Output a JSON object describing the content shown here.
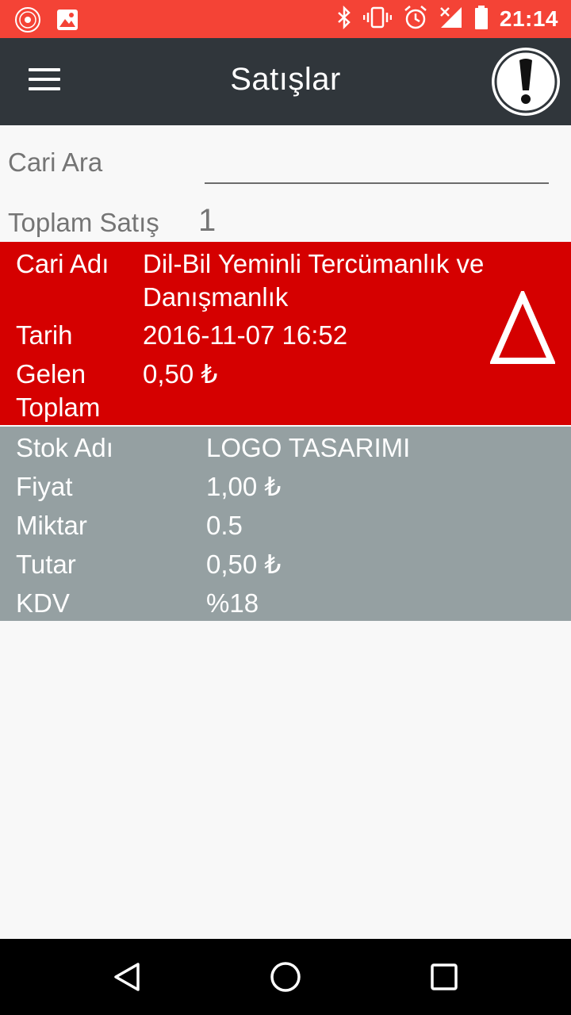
{
  "status_bar": {
    "time": "21:14",
    "left_icons": [
      "app-logo-icon",
      "image-icon"
    ],
    "right_icons": [
      "bluetooth-icon",
      "vibrate-icon",
      "alarm-icon",
      "signal-icon",
      "battery-icon"
    ]
  },
  "app_bar": {
    "title": "Satışlar",
    "menu_icon": "hamburger-menu-icon",
    "action_icon": "exclamation-icon"
  },
  "search": {
    "label": "Cari Ara",
    "value": "",
    "placeholder": ""
  },
  "summary": {
    "total_label": "Toplam Satış",
    "total_value": "1"
  },
  "sale": {
    "customer_label": "Cari Adı",
    "customer_value": "Dil-Bil Yeminli Tercümanlık ve Danışmanlık",
    "date_label": "Tarih",
    "date_value": "2016-11-07 16:52",
    "total_label": "Gelen Toplam",
    "total_value": "0,50 ₺",
    "status_icon": "warning-triangle-icon"
  },
  "item": {
    "stock_label": "Stok Adı",
    "stock_value": "LOGO TASARIMI",
    "price_label": "Fiyat",
    "price_value": "1,00 ₺",
    "quantity_label": "Miktar",
    "quantity_value": "0.5",
    "amount_label": "Tutar",
    "amount_value": "0,50 ₺",
    "vat_label": "KDV",
    "vat_value": "%18"
  },
  "nav_bar": {
    "buttons": [
      "back-icon",
      "home-icon",
      "recents-icon"
    ]
  },
  "colors": {
    "status_bar": "#f44336",
    "app_bar": "#30363b",
    "sale_card": "#d50000",
    "item_card": "#95a0a2",
    "background": "#f8f8f8",
    "nav_bar": "#000000"
  }
}
